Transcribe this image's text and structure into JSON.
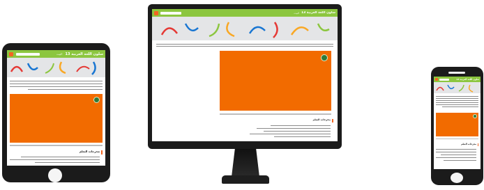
{
  "site": {
    "title": "سلون اللغة العربية 13",
    "breadcrumb": "البيت",
    "colors": {
      "header_green": "#8cc63f",
      "accent_orange": "#f26522",
      "video_orange": "#f26b00",
      "device_frame": "#1b1b1b"
    }
  },
  "section": {
    "heading": "مخرجات التعلم"
  },
  "icons": [
    "logo-icon",
    "search-icon",
    "video-badge-icon"
  ]
}
